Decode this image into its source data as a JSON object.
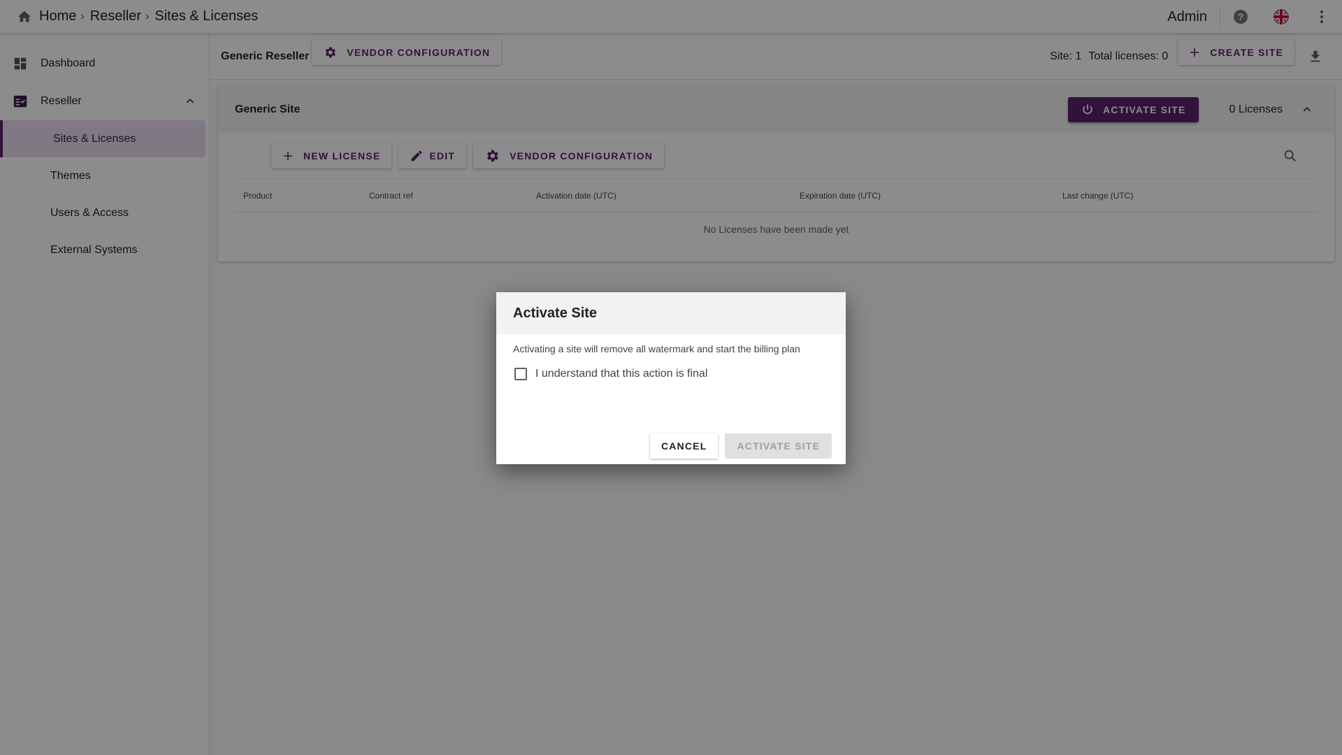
{
  "breadcrumb": {
    "home": "Home",
    "reseller": "Reseller",
    "current": "Sites & Licenses",
    "separator": "›"
  },
  "topbar": {
    "user": "Admin"
  },
  "sidebar": {
    "dashboard": "Dashboard",
    "reseller": "Reseller",
    "sites_licenses": "Sites & Licenses",
    "themes": "Themes",
    "users_access": "Users & Access",
    "external_systems": "External Systems"
  },
  "header": {
    "reseller_name": "Generic Reseller",
    "vendor_config": "VENDOR CONFIGURATION",
    "site_count": "Site: 1",
    "total_licenses": "Total licenses: 0",
    "create_site": "CREATE SITE"
  },
  "site": {
    "name": "Generic Site",
    "activate": "ACTIVATE SITE",
    "licenses": "0 Licenses",
    "new_license": "NEW LICENSE",
    "edit": "EDIT",
    "vendor_config": "VENDOR CONFIGURATION",
    "columns": [
      "Product",
      "Contract ref",
      "Activation date (UTC)",
      "Expiration date (UTC)",
      "Last change (UTC)"
    ],
    "empty": "No Licenses have been made yet"
  },
  "dialog": {
    "title": "Activate Site",
    "text": "Activating a site will remove all watermark and start the billing plan",
    "checkbox_label": "I understand that this action is final",
    "checked": false,
    "cancel": "CANCEL",
    "confirm": "ACTIVATE SITE"
  },
  "colors": {
    "accent": "#5c1f6e",
    "active_bg": "#eadcf0"
  }
}
